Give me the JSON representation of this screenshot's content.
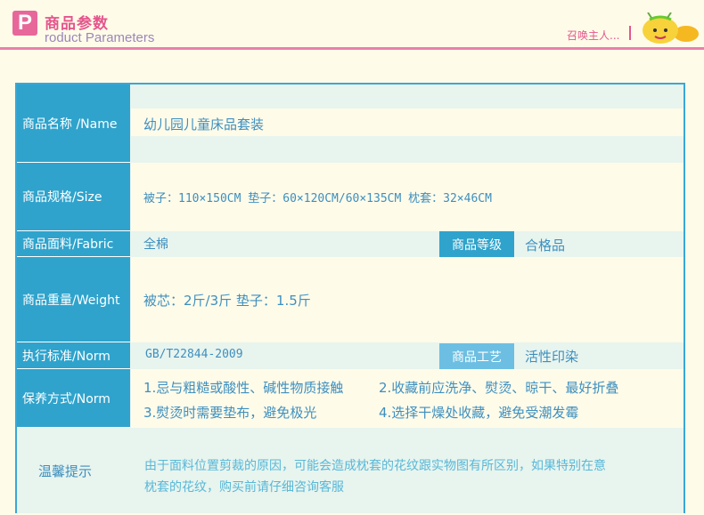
{
  "header": {
    "logo_letter": "P",
    "title_cn": "商品参数",
    "title_en": "roduct Parameters",
    "summon": "召唤主人..."
  },
  "rows": {
    "name": {
      "label": "商品名称 /Name",
      "value": "幼儿园儿童床品套装"
    },
    "size": {
      "label": "商品规格/Size",
      "value": "被子：110×150CM  垫子：60×120CM/60×135CM 枕套：32×46CM"
    },
    "fabric": {
      "label": "商品面料/Fabric",
      "value": "全棉",
      "grade_label": "商品等级",
      "grade_value": "合格品"
    },
    "weight": {
      "label": "商品重量/Weight",
      "value": "被芯：2斤/3斤 垫子：1.5斤"
    },
    "norm": {
      "label": "执行标准/Norm",
      "value": "GB/T22844-2009",
      "craft_label": "商品工艺",
      "craft_value": "活性印染"
    },
    "care": {
      "label": "保养方式/Norm",
      "items": [
        "1.忌与粗糙或酸性、碱性物质接触",
        "2.收藏前应洗净、熨烫、晾干、最好折叠",
        "3.熨烫时需要垫布，避免极光",
        "4.选择干燥处收藏，避免受潮发霉"
      ]
    },
    "tip": {
      "label": "温馨提示",
      "line1": "由于面料位置剪裁的原因，可能会造成枕套的花纹跟实物图有所区别，如果特别在意",
      "line2": "枕套的花纹，购买前请仔细咨询客服"
    }
  },
  "colors": {
    "accent_blue": "#2fa3cc",
    "pink": "#e4568d",
    "text_blue": "#3d8fbf",
    "cream": "#fffbe9"
  }
}
